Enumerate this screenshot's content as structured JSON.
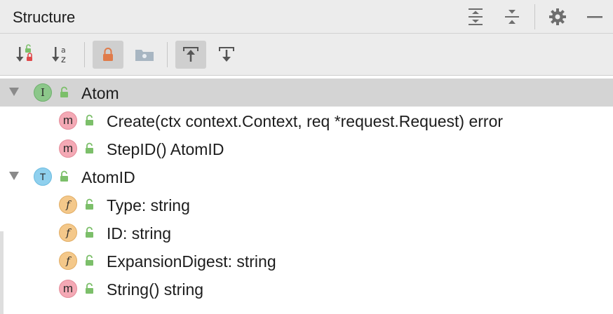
{
  "panel": {
    "title": "Structure",
    "header_icons": [
      "expand-all-icon",
      "collapse-all-icon",
      "gear-icon",
      "minimize-icon"
    ]
  },
  "toolbar": {
    "buttons": [
      {
        "name": "sort-by-visibility-icon",
        "pressed": false
      },
      {
        "name": "sort-alphabetically-icon",
        "pressed": false
      },
      {
        "name": "show-non-public-icon",
        "pressed": true
      },
      {
        "name": "show-fields-folder-icon",
        "pressed": false
      },
      {
        "name": "autoscroll-to-source-icon",
        "pressed": true
      },
      {
        "name": "autoscroll-from-source-icon",
        "pressed": false
      }
    ]
  },
  "colors": {
    "selected_row": "#d4d4d4",
    "method_badge": "#f4a9b5",
    "interface_badge": "#8cc78a",
    "type_badge": "#8fd0ee",
    "field_badge": "#f4c88a",
    "lock_green": "#7cbf6a",
    "lock_orange": "#e07b4a"
  },
  "tree": {
    "rows": [
      {
        "kind": "interface",
        "badge": "I",
        "label": "Atom",
        "level": 0,
        "expanded": true,
        "selected": true
      },
      {
        "kind": "method",
        "badge": "m",
        "label": "Create(ctx context.Context, req *request.Request) error",
        "level": 1
      },
      {
        "kind": "method",
        "badge": "m",
        "label": "StepID() AtomID",
        "level": 1
      },
      {
        "kind": "type",
        "badge": "T",
        "label": "AtomID",
        "level": 0,
        "expanded": true
      },
      {
        "kind": "field",
        "badge": "f",
        "label": "Type: string",
        "level": 1
      },
      {
        "kind": "field",
        "badge": "f",
        "label": "ID: string",
        "level": 1
      },
      {
        "kind": "field",
        "badge": "f",
        "label": "ExpansionDigest: string",
        "level": 1
      },
      {
        "kind": "method",
        "badge": "m",
        "label": "String() string",
        "level": 1
      }
    ]
  }
}
